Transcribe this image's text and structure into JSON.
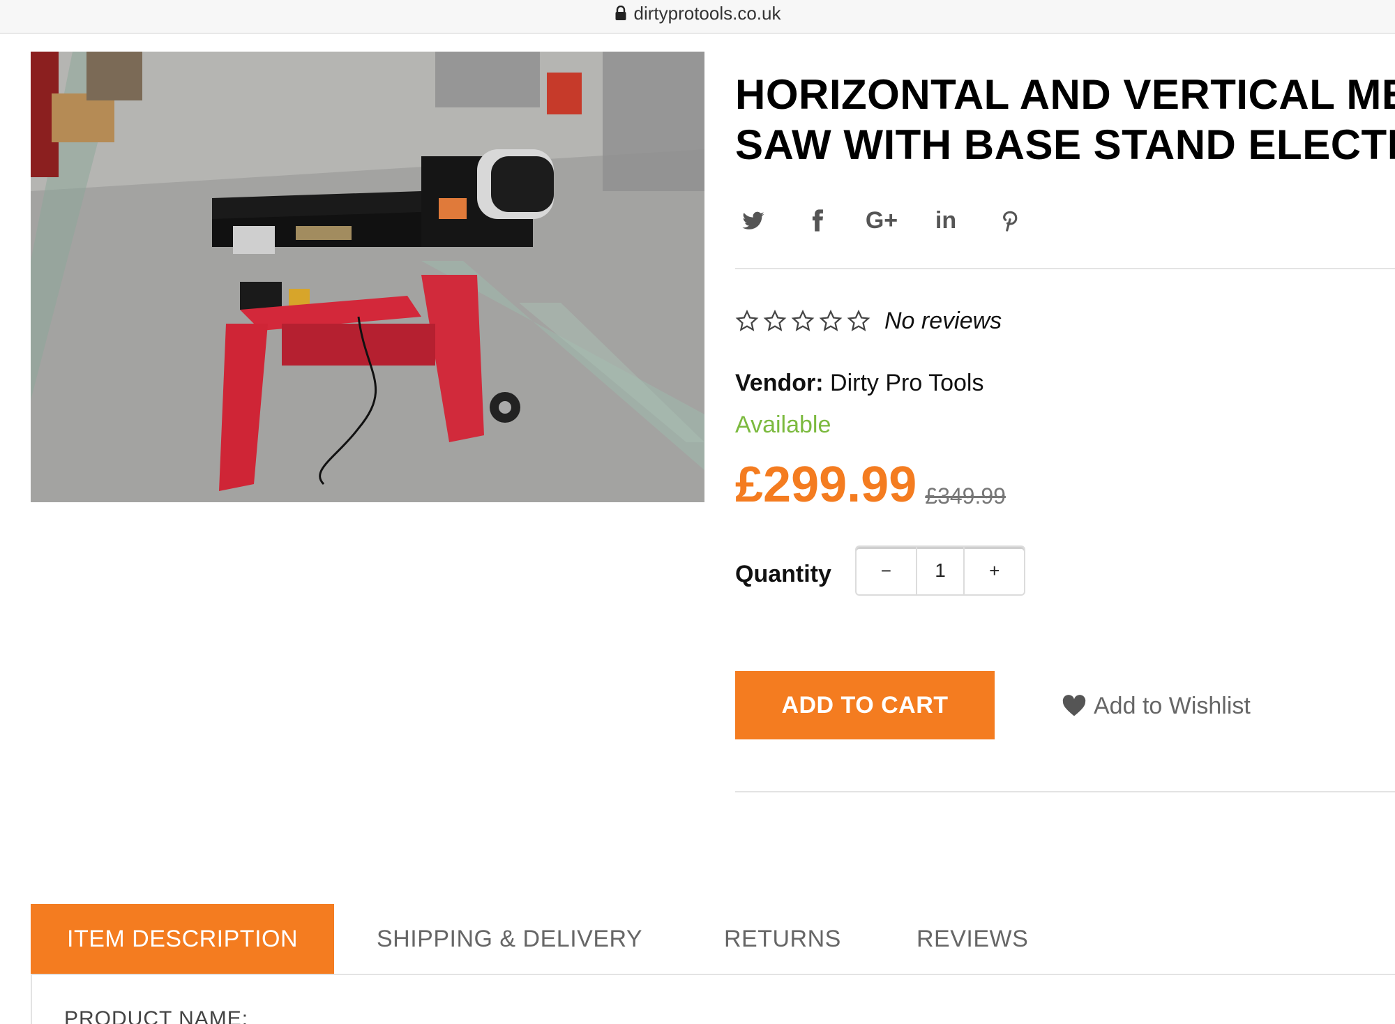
{
  "browser": {
    "url": "dirtyprotools.co.uk"
  },
  "product": {
    "title_line1": "HORIZONTAL AND VERTICAL ME",
    "title_line2": "SAW WITH BASE STAND ELECTR",
    "rating": {
      "stars_filled": 0,
      "stars_total": 5,
      "label": "No reviews"
    },
    "vendor_label": "Vendor:",
    "vendor_name": "Dirty Pro Tools",
    "availability": "Available",
    "price": "£299.99",
    "compare_price": "£349.99",
    "quantity_label": "Quantity",
    "quantity_value": "1",
    "qty_minus": "−",
    "qty_plus": "+",
    "add_to_cart": "ADD TO CART",
    "wishlist": "Add to Wishlist"
  },
  "share": {
    "icons": [
      "twitter-icon",
      "facebook-icon",
      "google-plus-icon",
      "linkedin-icon",
      "pinterest-icon"
    ],
    "google_plus_text": "G+",
    "linkedin_text": "in"
  },
  "tabs": [
    {
      "label": "ITEM DESCRIPTION",
      "active": true
    },
    {
      "label": "SHIPPING & DELIVERY",
      "active": false
    },
    {
      "label": "RETURNS",
      "active": false
    },
    {
      "label": "REVIEWS",
      "active": false
    }
  ],
  "tab_panel": {
    "first_line": "PRODUCT NAME:"
  },
  "colors": {
    "accent": "#f47c20",
    "available": "#7cba3f",
    "rule": "#e3e3e3"
  }
}
